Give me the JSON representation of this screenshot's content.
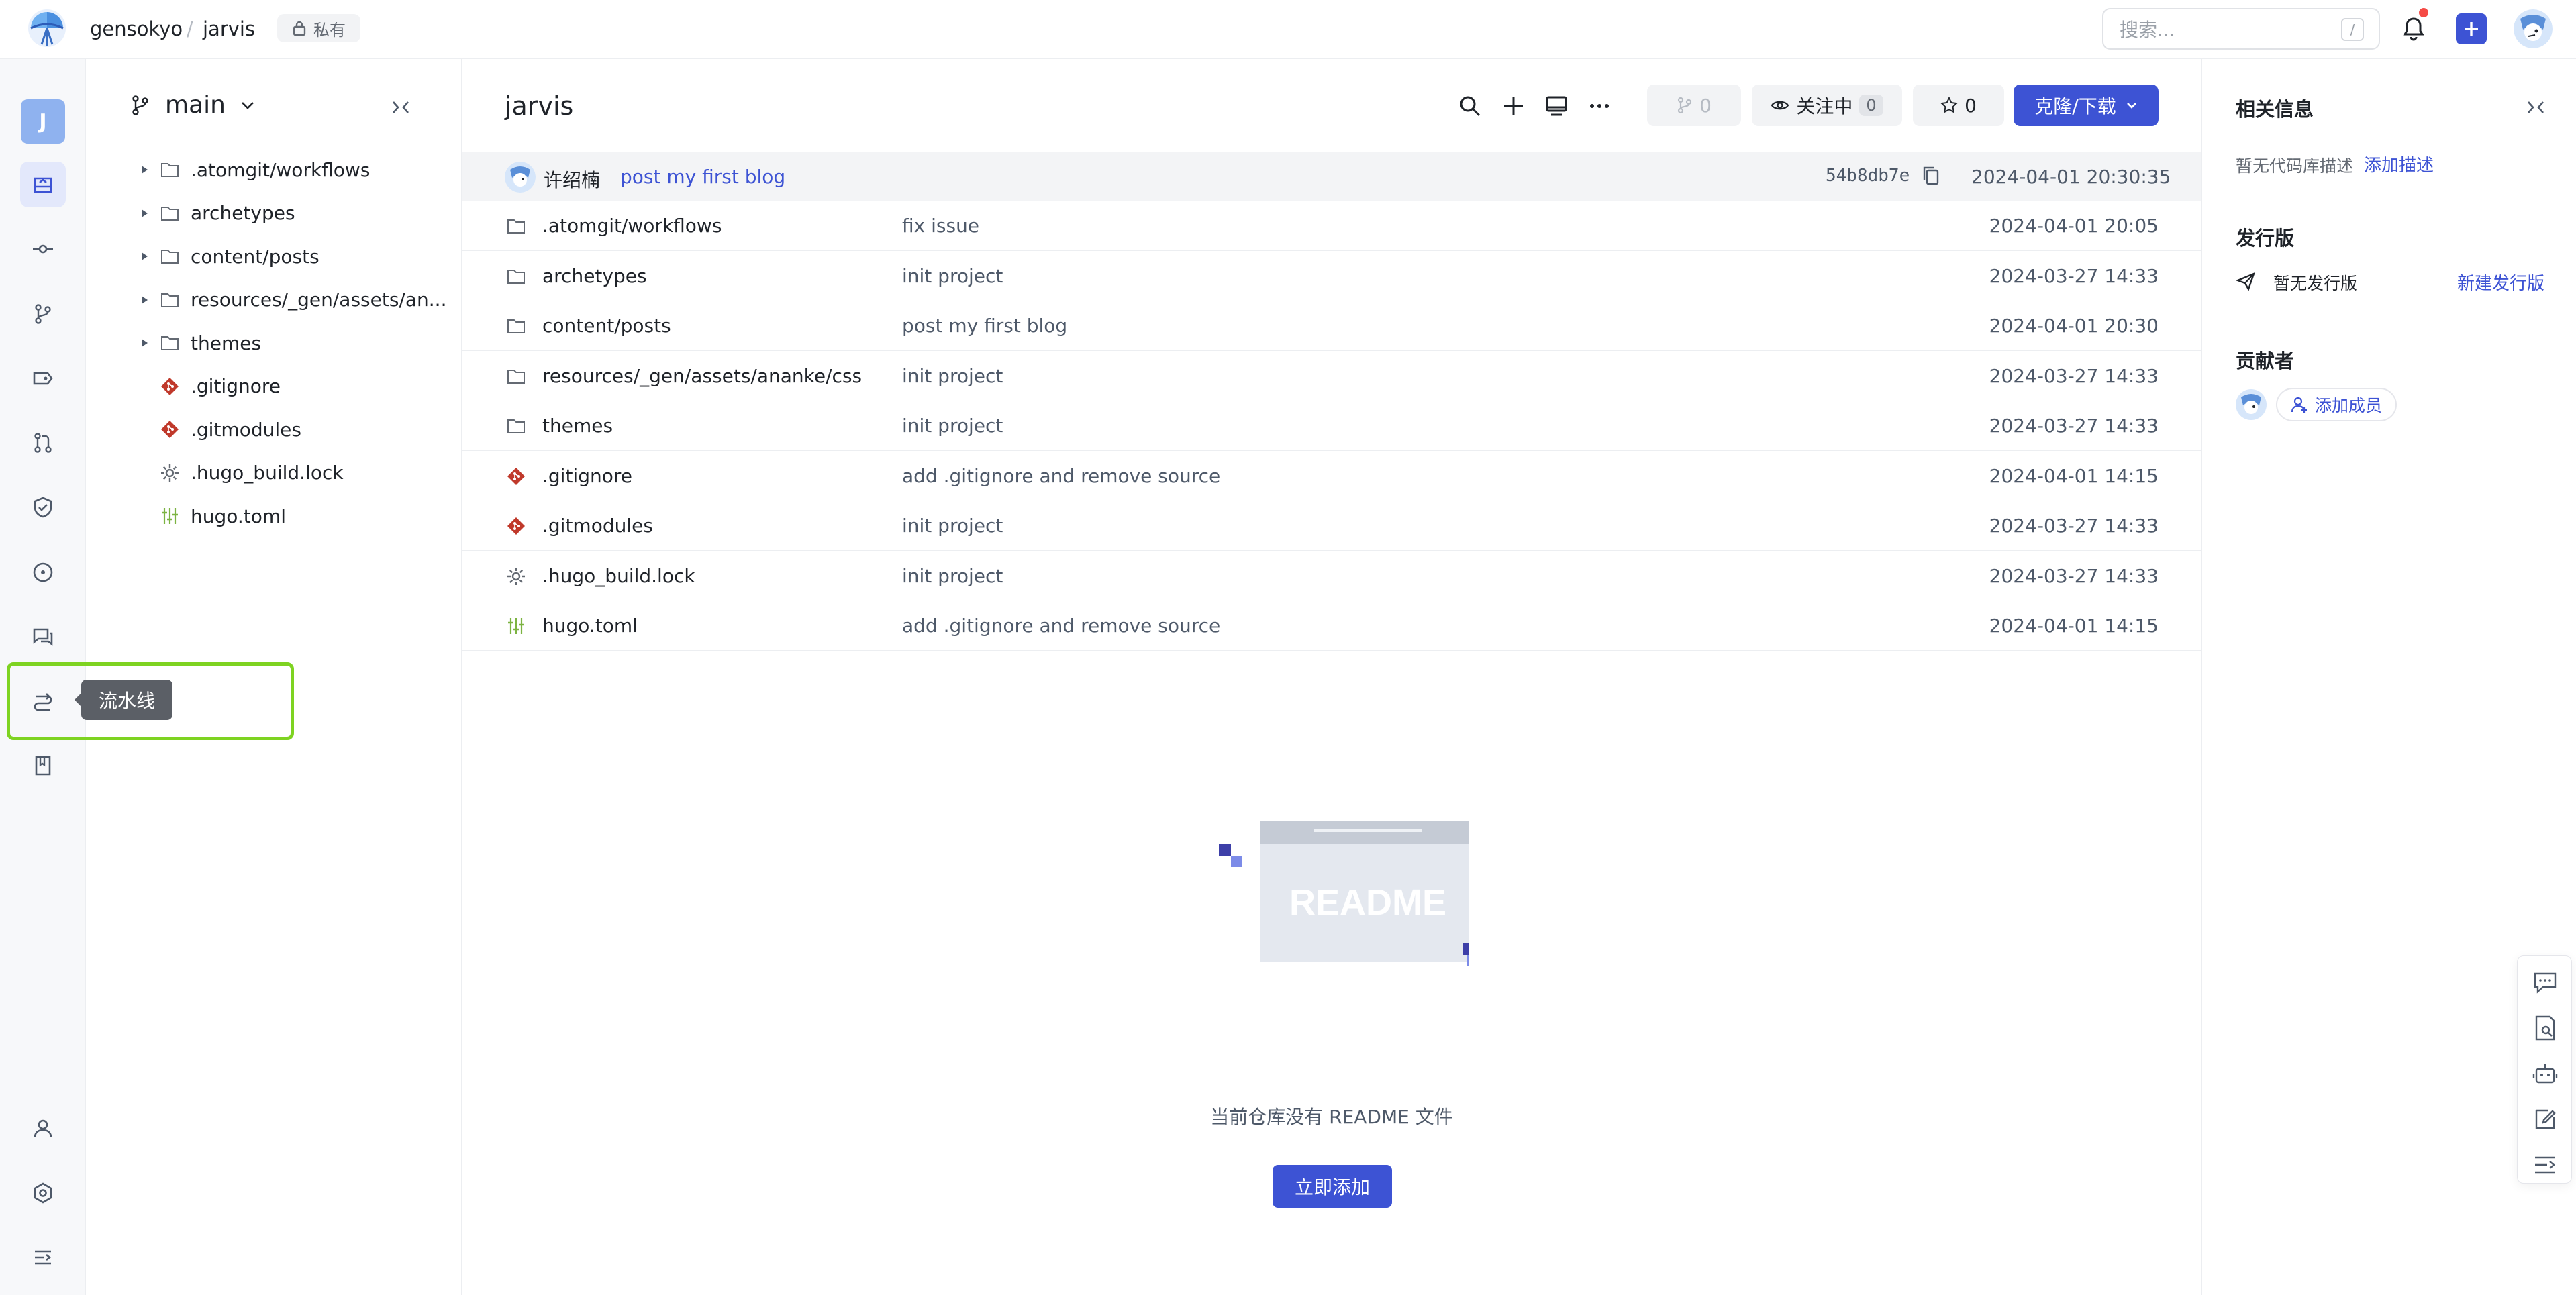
{
  "header": {
    "org": "gensokyo",
    "separator": "/",
    "repo": "jarvis",
    "visibility": "私有",
    "search_placeholder": "搜索...",
    "search_shortcut": "/"
  },
  "leftnav": {
    "project_initial": "J",
    "tooltip": "流水线",
    "items": [
      "repo-home-icon",
      "commit-icon",
      "branch-icon",
      "tag-icon",
      "pull-request-icon",
      "shield-check-icon",
      "issue-icon",
      "discussion-icon",
      "pipeline-icon",
      "wiki-icon",
      "member-icon",
      "settings-icon",
      "collapse-menu-icon"
    ]
  },
  "tree": {
    "branch": "main",
    "items": [
      {
        "type": "folder",
        "name": ".atomgit/workflows"
      },
      {
        "type": "folder",
        "name": "archetypes"
      },
      {
        "type": "folder",
        "name": "content/posts"
      },
      {
        "type": "folder",
        "name": "resources/_gen/assets/an..."
      },
      {
        "type": "folder",
        "name": "themes"
      },
      {
        "type": "git",
        "name": ".gitignore"
      },
      {
        "type": "git",
        "name": ".gitmodules"
      },
      {
        "type": "gear",
        "name": ".hugo_build.lock"
      },
      {
        "type": "toml",
        "name": "hugo.toml"
      }
    ]
  },
  "main": {
    "title": "jarvis",
    "fork_count": "0",
    "watch_label": "关注中",
    "watch_count": "0",
    "star_count": "0",
    "clone_label": "克隆/下载",
    "last_commit": {
      "author": "许绍楠",
      "message": "post my first blog",
      "hash": "54b8db7e",
      "time": "2024-04-01 20:30:35"
    },
    "files": [
      {
        "type": "folder",
        "name": ".atomgit/workflows",
        "message": "fix issue",
        "date": "2024-04-01 20:05"
      },
      {
        "type": "folder",
        "name": "archetypes",
        "message": "init project",
        "date": "2024-03-27 14:33"
      },
      {
        "type": "folder",
        "name": "content/posts",
        "message": "post my first blog",
        "date": "2024-04-01 20:30"
      },
      {
        "type": "folder",
        "name": "resources/_gen/assets/ananke/css",
        "message": "init project",
        "date": "2024-03-27 14:33"
      },
      {
        "type": "folder",
        "name": "themes",
        "message": "init project",
        "date": "2024-03-27 14:33"
      },
      {
        "type": "git",
        "name": ".gitignore",
        "message": "add .gitignore and remove source",
        "date": "2024-04-01 14:15"
      },
      {
        "type": "git",
        "name": ".gitmodules",
        "message": "init project",
        "date": "2024-03-27 14:33"
      },
      {
        "type": "gear",
        "name": ".hugo_build.lock",
        "message": "init project",
        "date": "2024-03-27 14:33"
      },
      {
        "type": "toml",
        "name": "hugo.toml",
        "message": "add .gitignore and remove source",
        "date": "2024-04-01 14:15"
      }
    ],
    "readme_art_text": "README",
    "readme_empty_text": "当前仓库没有 README 文件",
    "readme_add_button": "立即添加"
  },
  "right": {
    "info_title": "相关信息",
    "no_description": "暂无代码库描述",
    "add_description": "添加描述",
    "releases_title": "发行版",
    "no_release": "暂无发行版",
    "new_release": "新建发行版",
    "contributors_title": "贡献者",
    "add_member": "添加成员"
  },
  "colors": {
    "accent": "#3d53d4",
    "highlight": "#7ed321",
    "git_icon": "#c0392b"
  }
}
